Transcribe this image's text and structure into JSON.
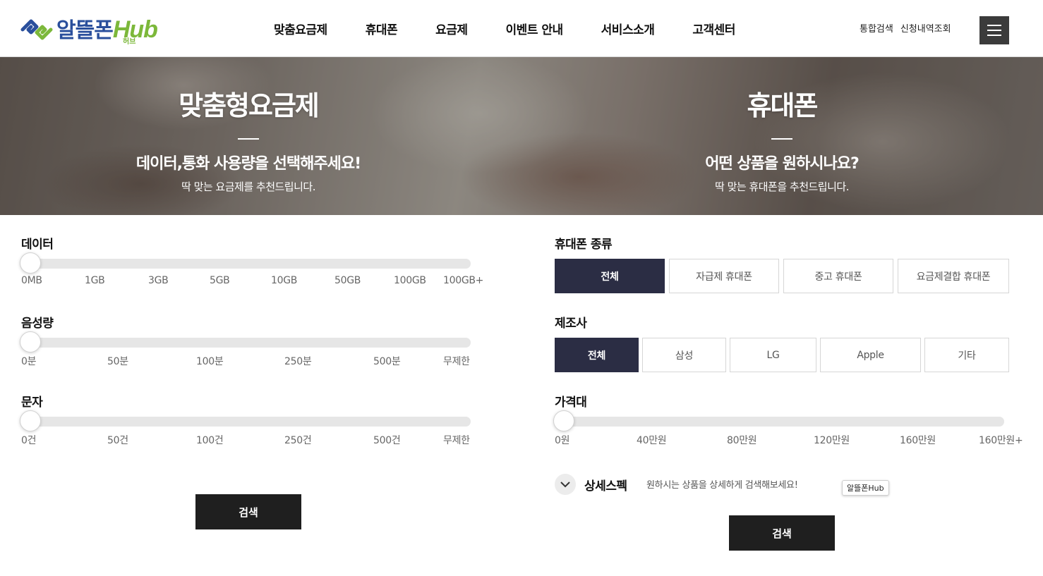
{
  "header": {
    "logo_text": "알뜰폰",
    "logo_hub": "Hub",
    "logo_sub": "허브",
    "nav": [
      "맞춤요금제",
      "휴대폰",
      "요금제",
      "이벤트 안내",
      "서비스소개",
      "고객센터"
    ],
    "util": [
      "통합검색",
      "신청내역조회"
    ]
  },
  "banner": {
    "left": {
      "title": "맞춤형요금제",
      "sub": "데이터,통화 사용량을 선택해주세요!",
      "desc": "딱 맞는 요금제를 추천드립니다."
    },
    "right": {
      "title": "휴대폰",
      "sub": "어떤 상품을 원하시나요?",
      "desc": "딱 맞는 휴대폰을 추천드립니다."
    }
  },
  "plan": {
    "data": {
      "label": "데이터",
      "ticks": [
        "0MB",
        "1GB",
        "3GB",
        "5GB",
        "10GB",
        "50GB",
        "100GB",
        "100GB+"
      ],
      "selected": "0MB"
    },
    "voice": {
      "label": "음성량",
      "ticks": [
        "0분",
        "50분",
        "100분",
        "250분",
        "500분",
        "무제한"
      ],
      "selected": "0분"
    },
    "sms": {
      "label": "문자",
      "ticks": [
        "0건",
        "50건",
        "100건",
        "250건",
        "500건",
        "무제한"
      ],
      "selected": "0건"
    },
    "search_label": "검색"
  },
  "phone": {
    "type": {
      "label": "휴대폰 종류",
      "options": [
        "전체",
        "자급제 휴대폰",
        "중고 휴대폰",
        "요금제결합 휴대폰"
      ],
      "selected": "전체"
    },
    "maker": {
      "label": "제조사",
      "options": [
        "전체",
        "삼성",
        "LG",
        "Apple",
        "기타"
      ],
      "selected": "전체"
    },
    "price": {
      "label": "가격대",
      "ticks": [
        "0원",
        "40만원",
        "80만원",
        "120만원",
        "160만원",
        "160만원+"
      ],
      "selected": "0원"
    },
    "spec": {
      "title": "상세스펙",
      "desc": "원하시는 상품을 상세하게 검색해보세요!"
    },
    "tooltip": "알뜰폰Hub",
    "search_label": "검색"
  },
  "colors": {
    "brand_blue": "#2a4f9c",
    "brand_green": "#7cb83a",
    "active": "#2b2d44",
    "button_dark": "#1f1f1f"
  }
}
